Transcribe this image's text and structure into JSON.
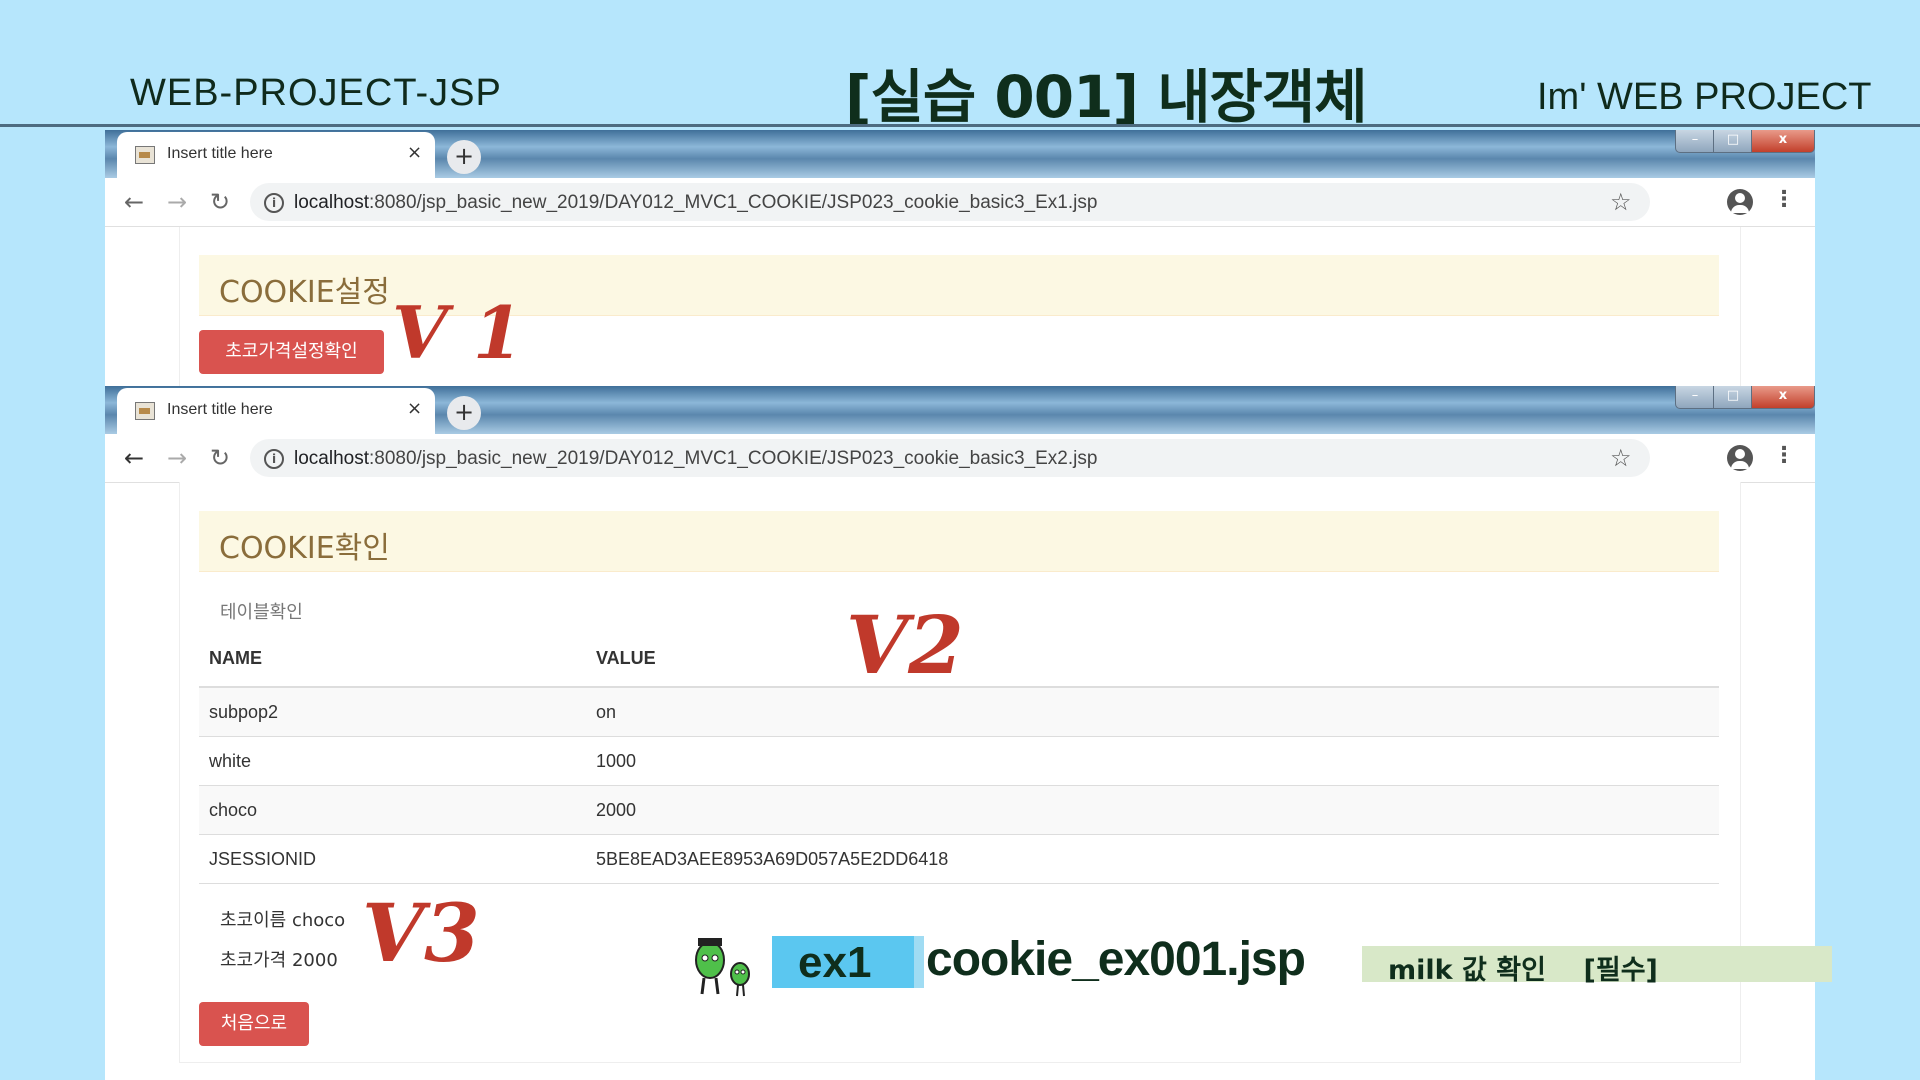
{
  "slide": {
    "left_title": "WEB-PROJECT-JSP",
    "center_title": "[실습 001]  내장객체",
    "right_title": "Im'  WEB PROJECT"
  },
  "window1": {
    "tab_title": "Insert title here",
    "tab_close": "×",
    "new_tab": "+",
    "url_host": "localhost",
    "url_path": ":8080/jsp_basic_new_2019/DAY012_MVC1_COOKIE/JSP023_cookie_basic3_Ex1.jsp",
    "heading": "COOKIE설정",
    "button": "초코가격설정확인"
  },
  "window2": {
    "tab_title": "Insert title here",
    "tab_close": "×",
    "new_tab": "+",
    "url_host": "localhost",
    "url_path": ":8080/jsp_basic_new_2019/DAY012_MVC1_COOKIE/JSP023_cookie_basic3_Ex2.jsp",
    "heading": "COOKIE확인",
    "caption": "테이블확인",
    "table": {
      "headers": [
        "NAME",
        "VALUE"
      ],
      "rows": [
        [
          "subpop2",
          "on"
        ],
        [
          "white",
          "1000"
        ],
        [
          "choco",
          "2000"
        ],
        [
          "JSESSIONID",
          "5BE8EAD3AEE8953A69D057A5E2DD6418"
        ]
      ]
    },
    "info_name": "초코이름 choco",
    "info_price": "초코가격 2000",
    "button": "처음으로"
  },
  "annotations": {
    "check1": "V 1",
    "check2": "V2",
    "check3": "V3"
  },
  "footer": {
    "ex_label": "ex1",
    "file_name": "cookie_ex001.jsp",
    "note": "milk 값 확인    [필수]"
  },
  "colors": {
    "background": "#b6e6fc",
    "panel_heading_bg": "#fcf8e3",
    "panel_heading_text": "#8a6d3b",
    "danger_button": "#d9534f",
    "check_mark": "#c0392b",
    "ex_box": "#5bc7f0",
    "note_box": "#d8e8c8"
  }
}
